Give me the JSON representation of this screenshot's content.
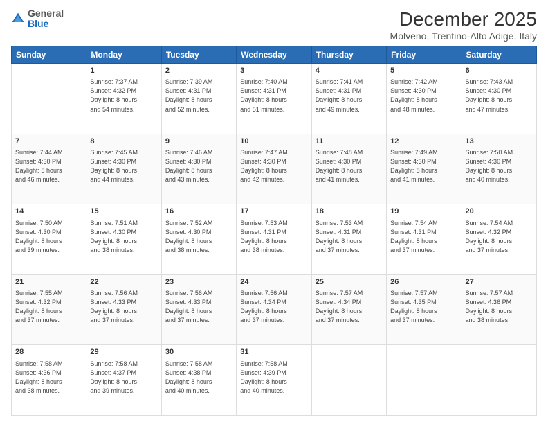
{
  "header": {
    "logo_general": "General",
    "logo_blue": "Blue",
    "title": "December 2025",
    "subtitle": "Molveno, Trentino-Alto Adige, Italy"
  },
  "days_of_week": [
    "Sunday",
    "Monday",
    "Tuesday",
    "Wednesday",
    "Thursday",
    "Friday",
    "Saturday"
  ],
  "weeks": [
    [
      {
        "day": "",
        "info": ""
      },
      {
        "day": "1",
        "info": "Sunrise: 7:37 AM\nSunset: 4:32 PM\nDaylight: 8 hours\nand 54 minutes."
      },
      {
        "day": "2",
        "info": "Sunrise: 7:39 AM\nSunset: 4:31 PM\nDaylight: 8 hours\nand 52 minutes."
      },
      {
        "day": "3",
        "info": "Sunrise: 7:40 AM\nSunset: 4:31 PM\nDaylight: 8 hours\nand 51 minutes."
      },
      {
        "day": "4",
        "info": "Sunrise: 7:41 AM\nSunset: 4:31 PM\nDaylight: 8 hours\nand 49 minutes."
      },
      {
        "day": "5",
        "info": "Sunrise: 7:42 AM\nSunset: 4:30 PM\nDaylight: 8 hours\nand 48 minutes."
      },
      {
        "day": "6",
        "info": "Sunrise: 7:43 AM\nSunset: 4:30 PM\nDaylight: 8 hours\nand 47 minutes."
      }
    ],
    [
      {
        "day": "7",
        "info": "Sunrise: 7:44 AM\nSunset: 4:30 PM\nDaylight: 8 hours\nand 46 minutes."
      },
      {
        "day": "8",
        "info": "Sunrise: 7:45 AM\nSunset: 4:30 PM\nDaylight: 8 hours\nand 44 minutes."
      },
      {
        "day": "9",
        "info": "Sunrise: 7:46 AM\nSunset: 4:30 PM\nDaylight: 8 hours\nand 43 minutes."
      },
      {
        "day": "10",
        "info": "Sunrise: 7:47 AM\nSunset: 4:30 PM\nDaylight: 8 hours\nand 42 minutes."
      },
      {
        "day": "11",
        "info": "Sunrise: 7:48 AM\nSunset: 4:30 PM\nDaylight: 8 hours\nand 41 minutes."
      },
      {
        "day": "12",
        "info": "Sunrise: 7:49 AM\nSunset: 4:30 PM\nDaylight: 8 hours\nand 41 minutes."
      },
      {
        "day": "13",
        "info": "Sunrise: 7:50 AM\nSunset: 4:30 PM\nDaylight: 8 hours\nand 40 minutes."
      }
    ],
    [
      {
        "day": "14",
        "info": "Sunrise: 7:50 AM\nSunset: 4:30 PM\nDaylight: 8 hours\nand 39 minutes."
      },
      {
        "day": "15",
        "info": "Sunrise: 7:51 AM\nSunset: 4:30 PM\nDaylight: 8 hours\nand 38 minutes."
      },
      {
        "day": "16",
        "info": "Sunrise: 7:52 AM\nSunset: 4:30 PM\nDaylight: 8 hours\nand 38 minutes."
      },
      {
        "day": "17",
        "info": "Sunrise: 7:53 AM\nSunset: 4:31 PM\nDaylight: 8 hours\nand 38 minutes."
      },
      {
        "day": "18",
        "info": "Sunrise: 7:53 AM\nSunset: 4:31 PM\nDaylight: 8 hours\nand 37 minutes."
      },
      {
        "day": "19",
        "info": "Sunrise: 7:54 AM\nSunset: 4:31 PM\nDaylight: 8 hours\nand 37 minutes."
      },
      {
        "day": "20",
        "info": "Sunrise: 7:54 AM\nSunset: 4:32 PM\nDaylight: 8 hours\nand 37 minutes."
      }
    ],
    [
      {
        "day": "21",
        "info": "Sunrise: 7:55 AM\nSunset: 4:32 PM\nDaylight: 8 hours\nand 37 minutes."
      },
      {
        "day": "22",
        "info": "Sunrise: 7:56 AM\nSunset: 4:33 PM\nDaylight: 8 hours\nand 37 minutes."
      },
      {
        "day": "23",
        "info": "Sunrise: 7:56 AM\nSunset: 4:33 PM\nDaylight: 8 hours\nand 37 minutes."
      },
      {
        "day": "24",
        "info": "Sunrise: 7:56 AM\nSunset: 4:34 PM\nDaylight: 8 hours\nand 37 minutes."
      },
      {
        "day": "25",
        "info": "Sunrise: 7:57 AM\nSunset: 4:34 PM\nDaylight: 8 hours\nand 37 minutes."
      },
      {
        "day": "26",
        "info": "Sunrise: 7:57 AM\nSunset: 4:35 PM\nDaylight: 8 hours\nand 37 minutes."
      },
      {
        "day": "27",
        "info": "Sunrise: 7:57 AM\nSunset: 4:36 PM\nDaylight: 8 hours\nand 38 minutes."
      }
    ],
    [
      {
        "day": "28",
        "info": "Sunrise: 7:58 AM\nSunset: 4:36 PM\nDaylight: 8 hours\nand 38 minutes."
      },
      {
        "day": "29",
        "info": "Sunrise: 7:58 AM\nSunset: 4:37 PM\nDaylight: 8 hours\nand 39 minutes."
      },
      {
        "day": "30",
        "info": "Sunrise: 7:58 AM\nSunset: 4:38 PM\nDaylight: 8 hours\nand 40 minutes."
      },
      {
        "day": "31",
        "info": "Sunrise: 7:58 AM\nSunset: 4:39 PM\nDaylight: 8 hours\nand 40 minutes."
      },
      {
        "day": "",
        "info": ""
      },
      {
        "day": "",
        "info": ""
      },
      {
        "day": "",
        "info": ""
      }
    ]
  ]
}
